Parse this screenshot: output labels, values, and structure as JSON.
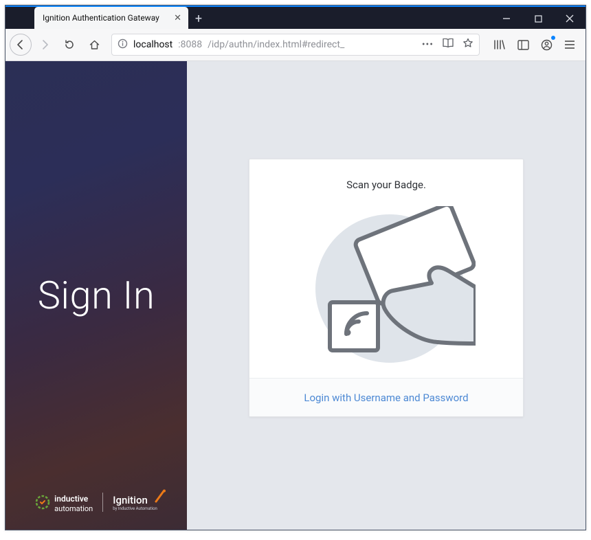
{
  "window": {
    "tab_title": "Ignition Authentication Gateway"
  },
  "toolbar": {
    "url_host": "localhost",
    "url_port": ":8088",
    "url_path": "/idp/authn/index.html#redirect_"
  },
  "brand": {
    "title": "Sign In",
    "logo1_top": "inductive",
    "logo1_bottom": "automation",
    "logo2_name": "Ignition",
    "logo2_sub": "by Inductive Automation"
  },
  "card": {
    "title": "Scan your Badge.",
    "footer_link": "Login with Username and Password"
  }
}
